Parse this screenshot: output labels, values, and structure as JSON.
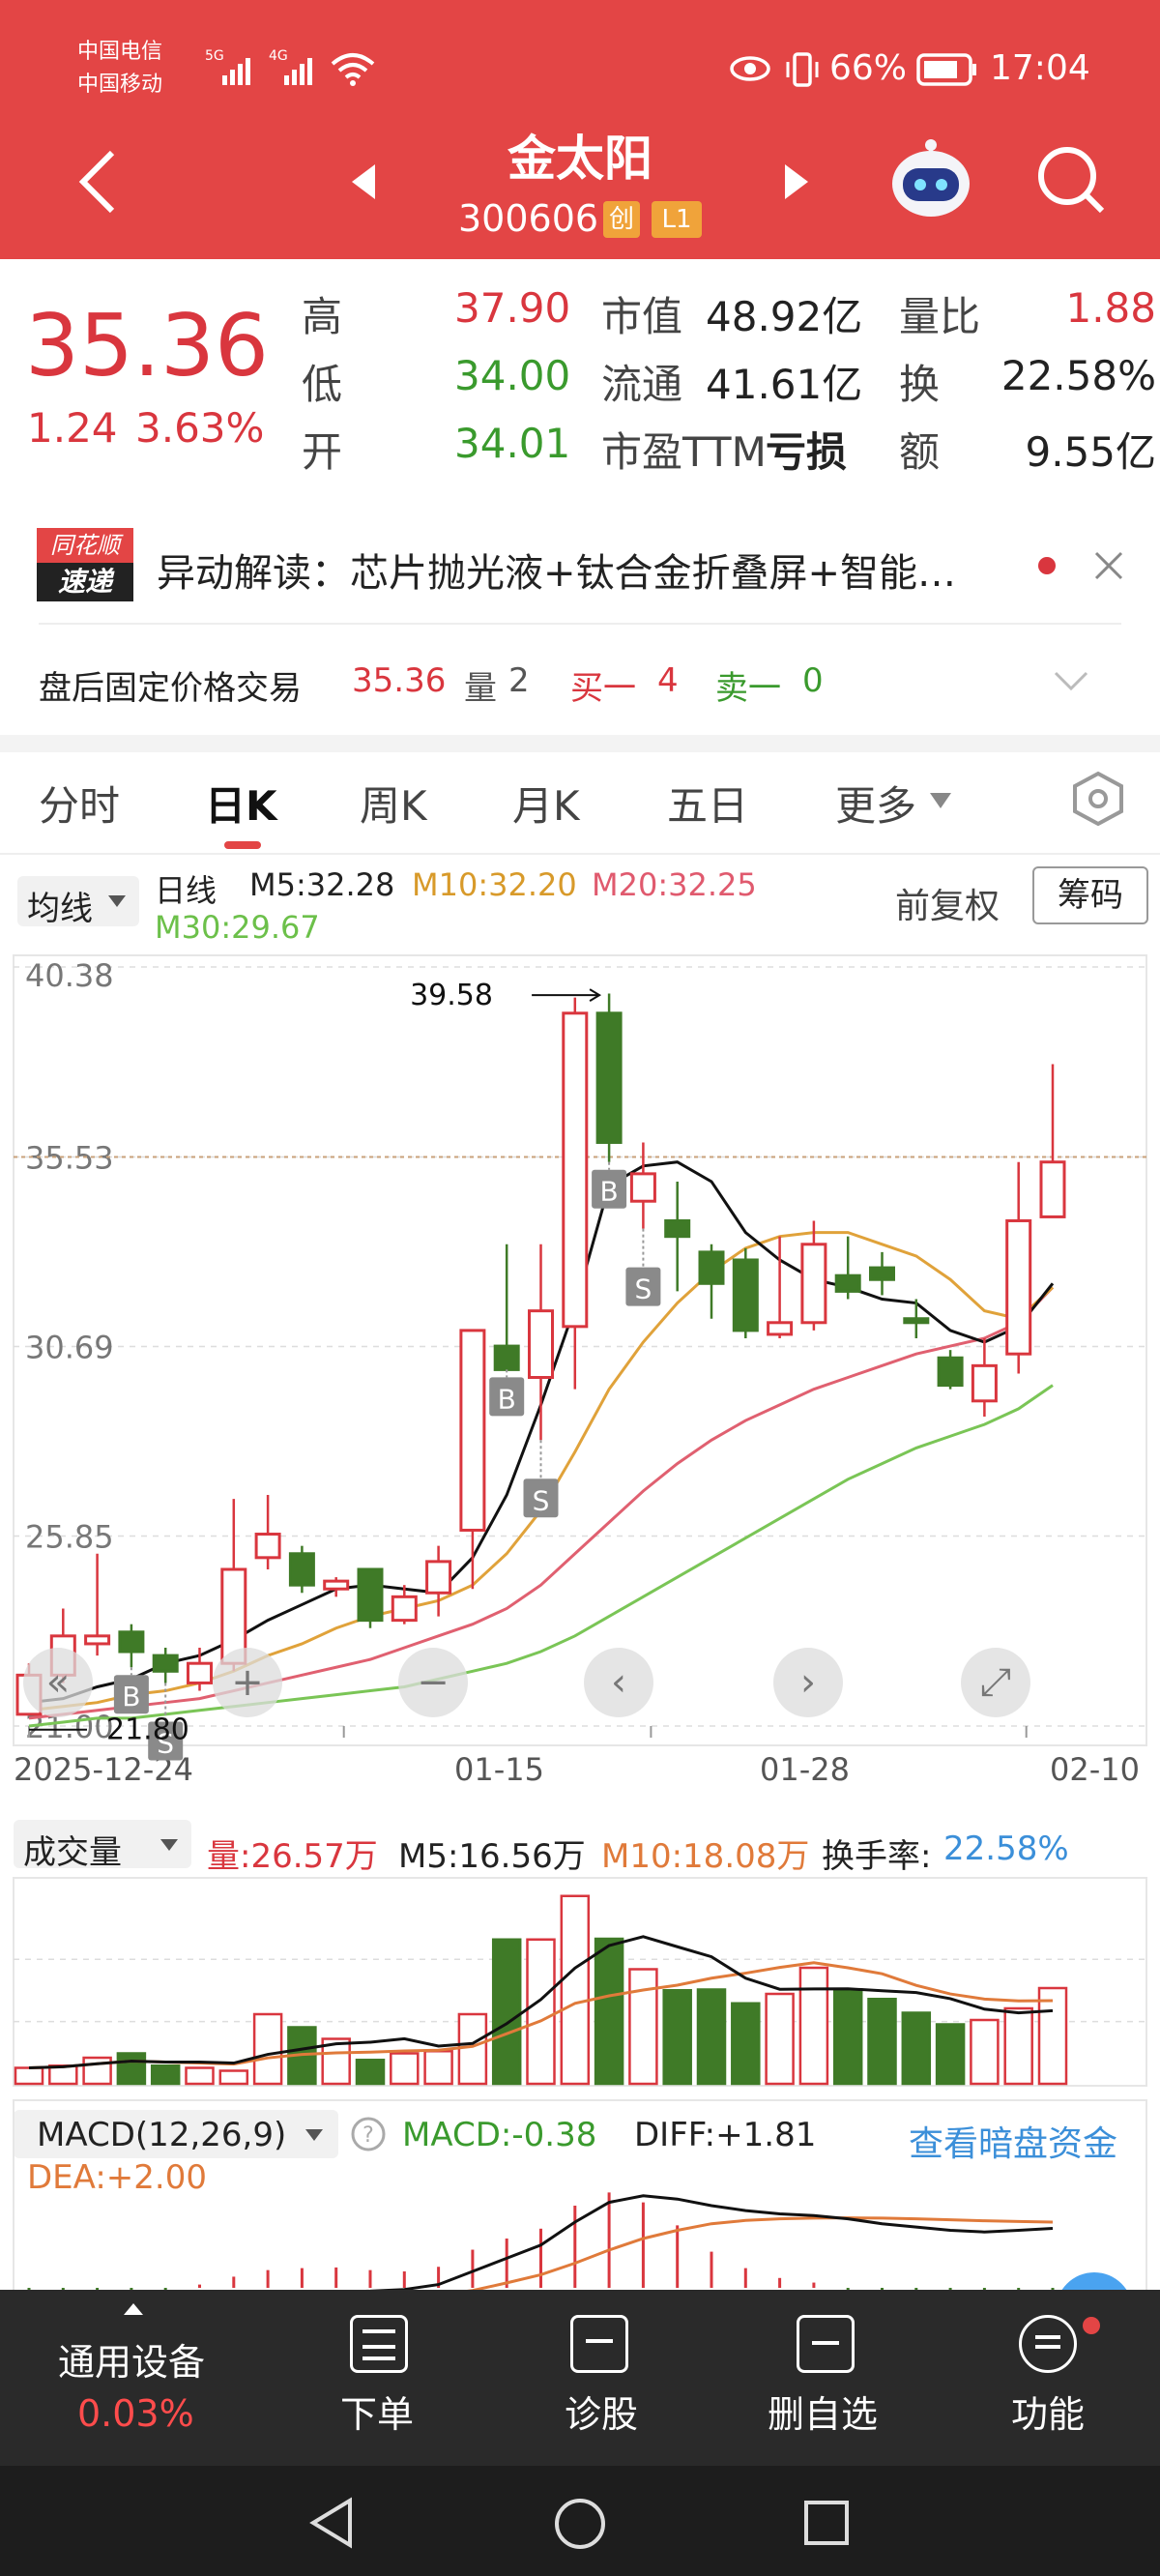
{
  "status_bar": {
    "carrier1": "中国电信",
    "carrier2": "中国移动",
    "net1": "5G",
    "net2": "4G",
    "battery": "66%",
    "time": "17:04"
  },
  "header": {
    "stock_name": "金太阳",
    "stock_code": "300606",
    "badge1": "创",
    "badge2": "L1"
  },
  "quote": {
    "price": "35.36",
    "change": "1.24",
    "change_pct": "3.63%",
    "rows": [
      {
        "l1": "高",
        "v1": "37.90",
        "l2": "市值",
        "v2": "48.92亿",
        "l3": "量比",
        "v3": "1.88"
      },
      {
        "l1": "低",
        "v1": "34.00",
        "l2": "流通",
        "v2": "41.61亿",
        "l3": "换",
        "v3": "22.58%"
      },
      {
        "l1": "开",
        "v1": "34.01",
        "l2": "市盈TTM",
        "v2": "亏损",
        "l3": "额",
        "v3": "9.55亿"
      }
    ]
  },
  "news": {
    "logo_top": "同花顺",
    "logo_bottom": "速递",
    "text": "异动解读：芯片抛光液+钛合金折叠屏+智能…"
  },
  "after_hours": {
    "label": "盘后固定价格交易",
    "price": "35.36",
    "vol_label": "量",
    "vol": "2",
    "buy_label": "买一",
    "buy": "4",
    "sell_label": "卖一",
    "sell": "0"
  },
  "tabs": [
    "分时",
    "日K",
    "周K",
    "月K",
    "五日",
    "更多"
  ],
  "active_tab": "日K",
  "ma_bar": {
    "selector": "均线",
    "period": "日线",
    "m5": "M5:32.28",
    "m10": "M10:32.20",
    "m20": "M20:32.25",
    "m30": "M30:29.67",
    "fq": "前复权",
    "chip": "筹码"
  },
  "colors": {
    "up": "#d9363e",
    "down": "#3f7a27",
    "ma5": "#111111",
    "ma10": "#e0a23a",
    "ma20": "#e06070",
    "ma30": "#7ac556",
    "header": "#e34545"
  },
  "chart_data": [
    {
      "type": "candlestick",
      "title": "",
      "y_ticks": [
        "40.38",
        "35.53",
        "30.69",
        "25.85",
        "21.00"
      ],
      "ylim": [
        21.0,
        40.38
      ],
      "x_ticks": [
        "2025-12-24",
        "01-15",
        "01-28",
        "02-10"
      ],
      "high_marker": "39.58",
      "low_marker": "21.80",
      "reference_price": 35.53,
      "candles": [
        {
          "o": 21.3,
          "c": 22.3,
          "h": 22.6,
          "l": 21.8
        },
        {
          "o": 22.3,
          "c": 23.3,
          "h": 24.0,
          "l": 22.1
        },
        {
          "o": 23.1,
          "c": 23.3,
          "h": 25.4,
          "l": 22.8
        },
        {
          "o": 23.4,
          "c": 22.9,
          "h": 23.6,
          "l": 22.5
        },
        {
          "o": 22.8,
          "c": 22.4,
          "h": 23.0,
          "l": 22.1
        },
        {
          "o": 22.1,
          "c": 22.6,
          "h": 23.0,
          "l": 21.9
        },
        {
          "o": 22.6,
          "c": 25.0,
          "h": 26.8,
          "l": 22.4
        },
        {
          "o": 25.3,
          "c": 25.9,
          "h": 26.9,
          "l": 25.0
        },
        {
          "o": 25.4,
          "c": 24.6,
          "h": 25.6,
          "l": 24.4
        },
        {
          "o": 24.5,
          "c": 24.7,
          "h": 24.8,
          "l": 24.3
        },
        {
          "o": 25.0,
          "c": 23.7,
          "h": 25.0,
          "l": 23.5
        },
        {
          "o": 23.7,
          "c": 24.3,
          "h": 24.6,
          "l": 23.6
        },
        {
          "o": 24.4,
          "c": 25.2,
          "h": 25.6,
          "l": 23.8
        },
        {
          "o": 26.0,
          "c": 31.1,
          "h": 31.1,
          "l": 24.5
        },
        {
          "o": 30.7,
          "c": 30.1,
          "h": 33.3,
          "l": 30.1
        },
        {
          "o": 29.9,
          "c": 31.6,
          "h": 33.3,
          "l": 28.3
        },
        {
          "o": 31.2,
          "c": 39.2,
          "h": 39.6,
          "l": 29.6
        },
        {
          "o": 39.2,
          "c": 35.9,
          "h": 39.7,
          "l": 35.4
        },
        {
          "o": 34.4,
          "c": 35.1,
          "h": 35.9,
          "l": 33.7
        },
        {
          "o": 33.9,
          "c": 33.5,
          "h": 34.9,
          "l": 32.1
        },
        {
          "o": 33.1,
          "c": 32.3,
          "h": 33.3,
          "l": 31.4
        },
        {
          "o": 32.9,
          "c": 31.1,
          "h": 33.2,
          "l": 30.9
        },
        {
          "o": 31.0,
          "c": 31.3,
          "h": 33.5,
          "l": 30.9
        },
        {
          "o": 31.3,
          "c": 33.3,
          "h": 33.9,
          "l": 31.1
        },
        {
          "o": 32.5,
          "c": 32.1,
          "h": 33.5,
          "l": 31.9
        },
        {
          "o": 32.7,
          "c": 32.4,
          "h": 33.1,
          "l": 32.0
        },
        {
          "o": 31.4,
          "c": 31.3,
          "h": 31.9,
          "l": 30.9
        },
        {
          "o": 30.4,
          "c": 29.7,
          "h": 30.6,
          "l": 29.6
        },
        {
          "o": 29.3,
          "c": 30.2,
          "h": 30.9,
          "l": 28.9
        },
        {
          "o": 30.5,
          "c": 33.9,
          "h": 35.4,
          "l": 30.0
        },
        {
          "o": 34.0,
          "c": 35.4,
          "h": 37.9,
          "l": 34.0
        }
      ],
      "ma5": [
        21.6,
        21.7,
        22.0,
        22.2,
        22.6,
        22.8,
        23.2,
        23.7,
        24.1,
        24.5,
        24.6,
        24.5,
        24.4,
        25.3,
        26.9,
        29.2,
        31.7,
        34.8,
        35.3,
        35.4,
        34.9,
        33.6,
        32.9,
        32.4,
        32.2,
        31.9,
        31.8,
        31.1,
        30.8,
        31.2,
        32.3
      ],
      "ma10": [
        21.4,
        21.5,
        21.6,
        21.8,
        21.9,
        22.1,
        22.4,
        22.8,
        23.1,
        23.5,
        23.8,
        24.0,
        24.2,
        24.6,
        25.4,
        26.5,
        28.0,
        29.6,
        30.8,
        31.8,
        32.6,
        33.2,
        33.5,
        33.6,
        33.6,
        33.3,
        33.0,
        32.4,
        31.6,
        31.4,
        32.2
      ],
      "ma20": [
        21.2,
        21.3,
        21.4,
        21.5,
        21.6,
        21.7,
        21.9,
        22.1,
        22.3,
        22.5,
        22.7,
        23.0,
        23.3,
        23.6,
        24.0,
        24.6,
        25.4,
        26.2,
        27.0,
        27.7,
        28.3,
        28.8,
        29.2,
        29.6,
        29.9,
        30.2,
        30.5,
        30.7,
        30.9,
        31.3,
        32.2
      ],
      "ma30": [
        21.0,
        21.1,
        21.2,
        21.2,
        21.3,
        21.4,
        21.5,
        21.6,
        21.7,
        21.8,
        21.9,
        22.0,
        22.2,
        22.4,
        22.6,
        22.9,
        23.3,
        23.8,
        24.3,
        24.8,
        25.3,
        25.8,
        26.3,
        26.8,
        27.3,
        27.7,
        28.1,
        28.4,
        28.7,
        29.1,
        29.7
      ],
      "signals": [
        {
          "i": 3,
          "label": "B"
        },
        {
          "i": 4,
          "label": "S"
        },
        {
          "i": 14,
          "label": "B"
        },
        {
          "i": 15,
          "label": "S"
        },
        {
          "i": 17,
          "label": "B"
        },
        {
          "i": 18,
          "label": "S"
        }
      ]
    },
    {
      "type": "bar",
      "title": "成交量",
      "labels": {
        "vol": "量:26.57万",
        "m5": "M5:16.56万",
        "m10": "M10:18.08万",
        "turnover_label": "换手率:",
        "turnover": "22.58%"
      },
      "values": [
        2.2,
        2.5,
        3.6,
        4.2,
        2.5,
        2.2,
        1.8,
        9.6,
        7.8,
        6.2,
        3.3,
        4.2,
        4.5,
        9.6,
        19.9,
        19.9,
        25.9,
        20.0,
        15.8,
        12.9,
        13.0,
        11.1,
        12.4,
        16.0,
        13.0,
        11.7,
        9.8,
        8.2,
        8.8,
        10.4,
        13.2
      ]
    },
    {
      "type": "line",
      "title": "MACD(12,26,9)",
      "labels": {
        "macd": "MACD:-0.38",
        "diff": "DIFF:+1.81",
        "dea": "DEA:+2.00",
        "link": "查看暗盘资金"
      },
      "diff": [
        -0.9,
        -0.85,
        -0.8,
        -0.75,
        -0.7,
        -0.6,
        -0.45,
        -0.3,
        -0.2,
        -0.12,
        -0.1,
        -0.05,
        0.1,
        0.5,
        0.9,
        1.3,
        2.0,
        2.6,
        2.8,
        2.7,
        2.5,
        2.35,
        2.25,
        2.2,
        2.1,
        1.95,
        1.85,
        1.75,
        1.7,
        1.75,
        1.81
      ],
      "dea": [
        -0.6,
        -0.62,
        -0.64,
        -0.65,
        -0.66,
        -0.65,
        -0.62,
        -0.57,
        -0.5,
        -0.43,
        -0.37,
        -0.3,
        -0.22,
        -0.08,
        0.15,
        0.4,
        0.75,
        1.15,
        1.5,
        1.75,
        1.95,
        2.05,
        2.1,
        2.12,
        2.13,
        2.12,
        2.1,
        2.07,
        2.04,
        2.02,
        2.0
      ]
    }
  ],
  "chart_controls": [
    "«",
    "+",
    "−",
    "‹",
    "›",
    "⤢"
  ],
  "bottom_bar": {
    "item1": "通用设备",
    "item1_value": "0.03%",
    "item2": "下单",
    "item3": "诊股",
    "item4": "删自选",
    "item5": "功能"
  }
}
